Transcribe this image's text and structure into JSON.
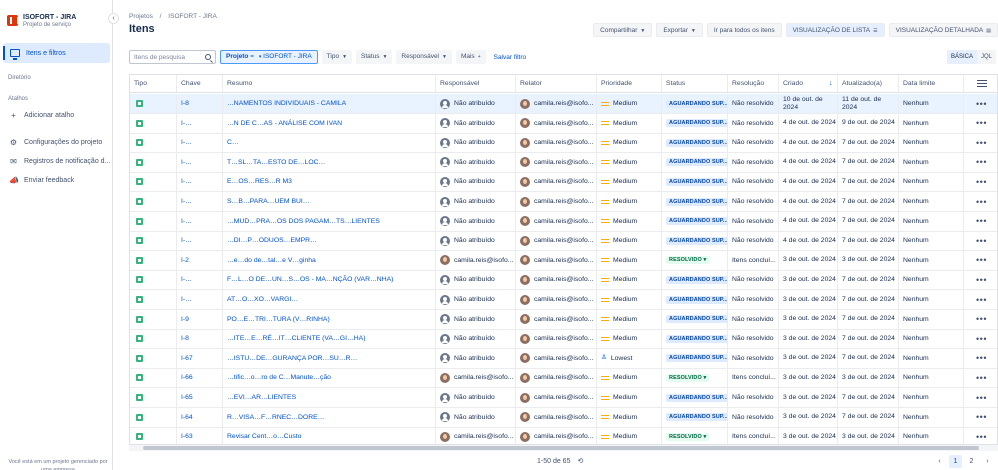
{
  "sidebar": {
    "project_name": "ISOFORT - JIRA",
    "project_type": "Projeto de serviço",
    "collapse_icon": "chevron-left-icon",
    "active_item": "Itens e filtros",
    "section_directory": "Diretório",
    "section_shortcuts": "Atalhos",
    "add_shortcut": "Adicionar atalho",
    "items": [
      {
        "label": "Configurações do projeto",
        "icon": "gear-icon"
      },
      {
        "label": "Registros de notificação d...",
        "icon": "mail-icon"
      },
      {
        "label": "Enviar feedback",
        "icon": "megaphone-icon"
      }
    ],
    "footer": "Você está em um projeto gerenciado por uma empresa"
  },
  "header": {
    "breadcrumb": [
      "Projetos",
      "/",
      "ISOFORT - JIRA"
    ],
    "title": "Itens",
    "share": "Compartilhar",
    "export": "Exportar",
    "goto_all": "Ir para todos os itens",
    "list_view": "VISUALIZAÇÃO DE LISTA",
    "detail_view": "VISUALIZAÇÃO DETALHADA"
  },
  "filters": {
    "search_placeholder": "Itens de pesquisa",
    "project_label": "Projeto",
    "project_op": "=",
    "project_value": "ISOFORT - JIRA",
    "type": "Tipo",
    "status": "Status",
    "assignee": "Responsável",
    "more": "Mais",
    "save": "Salvar filtro",
    "basic": "BÁSICA",
    "jql": "JQL"
  },
  "table": {
    "columns": [
      "Tipo",
      "Chave",
      "Resumo",
      "Responsável",
      "Relator",
      "Prioridade",
      "Status",
      "Resolução",
      "Criado",
      "Atualizado(a)",
      "Data limite"
    ],
    "rows": [
      {
        "key": "I-8",
        "summary": "…NAMENTOS INDIVIDUAIS - CAMILA",
        "assignee": "Não atribuído",
        "assignee_avatar": "unassigned",
        "reporter": "camila.reis@isofo...",
        "priority": "Medium",
        "status": "AGUARDANDO SUP...",
        "resolution": "Não resolvido",
        "created": "10 de out. de 2024",
        "updated": "11 de out. de 2024",
        "due": "Nenhum"
      },
      {
        "key": "I-…",
        "summary": "…N DE C…AS - ANÁLISE COM IVAN",
        "assignee": "Não atribuído",
        "assignee_avatar": "unassigned",
        "reporter": "camila.reis@isofo...",
        "priority": "Medium",
        "status": "AGUARDANDO SUP...",
        "resolution": "Não resolvido",
        "created": "4 de out. de 2024",
        "updated": "9 de out. de 2024",
        "due": "Nenhum"
      },
      {
        "key": "I-…",
        "summary": "C…",
        "assignee": "Não atribuído",
        "assignee_avatar": "unassigned",
        "reporter": "camila.reis@isofo...",
        "priority": "Medium",
        "status": "AGUARDANDO SUP...",
        "resolution": "Não resolvido",
        "created": "4 de out. de 2024",
        "updated": "7 de out. de 2024",
        "due": "Nenhum"
      },
      {
        "key": "I-…",
        "summary": "T…SL…TA…ESTO DE…LOC…",
        "assignee": "Não atribuído",
        "assignee_avatar": "unassigned",
        "reporter": "camila.reis@isofo...",
        "priority": "Medium",
        "status": "AGUARDANDO SUP...",
        "resolution": "Não resolvido",
        "created": "4 de out. de 2024",
        "updated": "7 de out. de 2024",
        "due": "Nenhum"
      },
      {
        "key": "I-…",
        "summary": "E…OS…RES…R M3",
        "assignee": "Não atribuído",
        "assignee_avatar": "unassigned",
        "reporter": "camila.reis@isofo...",
        "priority": "Medium",
        "status": "AGUARDANDO SUP...",
        "resolution": "Não resolvido",
        "created": "4 de out. de 2024",
        "updated": "7 de out. de 2024",
        "due": "Nenhum"
      },
      {
        "key": "I-…",
        "summary": "S…B…PARA…UEM BUI…",
        "assignee": "Não atribuído",
        "assignee_avatar": "unassigned",
        "reporter": "camila.reis@isofo...",
        "priority": "Medium",
        "status": "AGUARDANDO SUP...",
        "resolution": "Não resolvido",
        "created": "4 de out. de 2024",
        "updated": "7 de out. de 2024",
        "due": "Nenhum"
      },
      {
        "key": "I-…",
        "summary": "…MUD…PRA…OS DOS PAGAM…TS…LIENTES",
        "assignee": "Não atribuído",
        "assignee_avatar": "unassigned",
        "reporter": "camila.reis@isofo...",
        "priority": "Medium",
        "status": "AGUARDANDO SUP...",
        "resolution": "Não resolvido",
        "created": "4 de out. de 2024",
        "updated": "7 de out. de 2024",
        "due": "Nenhum"
      },
      {
        "key": "I-…",
        "summary": "…DI…P…ODUOS…EMPR…",
        "assignee": "Não atribuído",
        "assignee_avatar": "unassigned",
        "reporter": "camila.reis@isofo...",
        "priority": "Medium",
        "status": "AGUARDANDO SUP...",
        "resolution": "Não resolvido",
        "created": "4 de out. de 2024",
        "updated": "7 de out. de 2024",
        "due": "Nenhum"
      },
      {
        "key": "I-2",
        "summary": "…e…do de…tal…e V…ginha",
        "assignee": "camila.reis@isofo...",
        "assignee_avatar": "person",
        "reporter": "camila.reis@isofo...",
        "priority": "Medium",
        "status": "RESOLVIDO",
        "resolution": "Itens concluí...",
        "created": "3 de out. de 2024",
        "updated": "3 de out. de 2024",
        "due": "Nenhum"
      },
      {
        "key": "I-…",
        "summary": "F…L…O DE…UN…S…OS - MA…NÇÃO (VAR…NHA)",
        "assignee": "Não atribuído",
        "assignee_avatar": "unassigned",
        "reporter": "camila.reis@isofo...",
        "priority": "Medium",
        "status": "AGUARDANDO SUP...",
        "resolution": "Não resolvido",
        "created": "3 de out. de 2024",
        "updated": "7 de out. de 2024",
        "due": "Nenhum"
      },
      {
        "key": "I-…",
        "summary": "AT…O…XO…VARGI…",
        "assignee": "Não atribuído",
        "assignee_avatar": "unassigned",
        "reporter": "camila.reis@isofo...",
        "priority": "Medium",
        "status": "AGUARDANDO SUP...",
        "resolution": "Não resolvido",
        "created": "3 de out. de 2024",
        "updated": "7 de out. de 2024",
        "due": "Nenhum"
      },
      {
        "key": "I-9",
        "summary": "PO…E…TRI…TURA (V…RINHA)",
        "assignee": "Não atribuído",
        "assignee_avatar": "unassigned",
        "reporter": "camila.reis@isofo...",
        "priority": "Medium",
        "status": "AGUARDANDO SUP...",
        "resolution": "Não resolvido",
        "created": "3 de out. de 2024",
        "updated": "7 de out. de 2024",
        "due": "Nenhum"
      },
      {
        "key": "I-8",
        "summary": "…ITE…E…RÉ…IT…CLIENTE (VA…GI…HA)",
        "assignee": "Não atribuído",
        "assignee_avatar": "unassigned",
        "reporter": "camila.reis@isofo...",
        "priority": "Medium",
        "status": "AGUARDANDO SUP...",
        "resolution": "Não resolvido",
        "created": "3 de out. de 2024",
        "updated": "7 de out. de 2024",
        "due": "Nenhum"
      },
      {
        "key": "I-67",
        "summary": "…ISTU…DE…GURANÇA POR…SU…R…",
        "assignee": "Não atribuído",
        "assignee_avatar": "unassigned",
        "reporter": "camila.reis@isofo...",
        "priority": "Lowest",
        "status": "AGUARDANDO SUP...",
        "resolution": "Não resolvido",
        "created": "3 de out. de 2024",
        "updated": "7 de out. de 2024",
        "due": "Nenhum"
      },
      {
        "key": "I-66",
        "summary": "…tific…o…ro de C…Manute…ção",
        "assignee": "camila.reis@isofo...",
        "assignee_avatar": "person",
        "reporter": "camila.reis@isofo...",
        "priority": "Medium",
        "status": "RESOLVIDO",
        "resolution": "Itens concluí...",
        "created": "3 de out. de 2024",
        "updated": "3 de out. de 2024",
        "due": "Nenhum"
      },
      {
        "key": "I-65",
        "summary": "…EVI…AR…LIENTES",
        "assignee": "Não atribuído",
        "assignee_avatar": "unassigned",
        "reporter": "camila.reis@isofo...",
        "priority": "Medium",
        "status": "AGUARDANDO SUP...",
        "resolution": "Não resolvido",
        "created": "3 de out. de 2024",
        "updated": "7 de out. de 2024",
        "due": "Nenhum"
      },
      {
        "key": "I-64",
        "summary": "R…VISA…F…RNEC…DORE…",
        "assignee": "Não atribuído",
        "assignee_avatar": "unassigned",
        "reporter": "camila.reis@isofo...",
        "priority": "Medium",
        "status": "AGUARDANDO SUP...",
        "resolution": "Não resolvido",
        "created": "3 de out. de 2024",
        "updated": "7 de out. de 2024",
        "due": "Nenhum"
      },
      {
        "key": "I-63",
        "summary": "Revisar Cent…o…Custo",
        "assignee": "camila.reis@isofo...",
        "assignee_avatar": "person",
        "reporter": "camila.reis@isofo...",
        "priority": "Medium",
        "status": "RESOLVIDO",
        "resolution": "Itens concluí...",
        "created": "3 de out. de 2024",
        "updated": "3 de out. de 2024",
        "due": "Nenhum"
      }
    ]
  },
  "pagination": {
    "count": "1-50 de 65",
    "pages": [
      "1",
      "2"
    ],
    "current": "1"
  },
  "colors": {
    "accent": "#0052cc",
    "waiting_bg": "#deebff",
    "resolved_bg": "#e3fcef",
    "medium_priority": "#ffab00",
    "lowest_priority": "#0065ff"
  }
}
